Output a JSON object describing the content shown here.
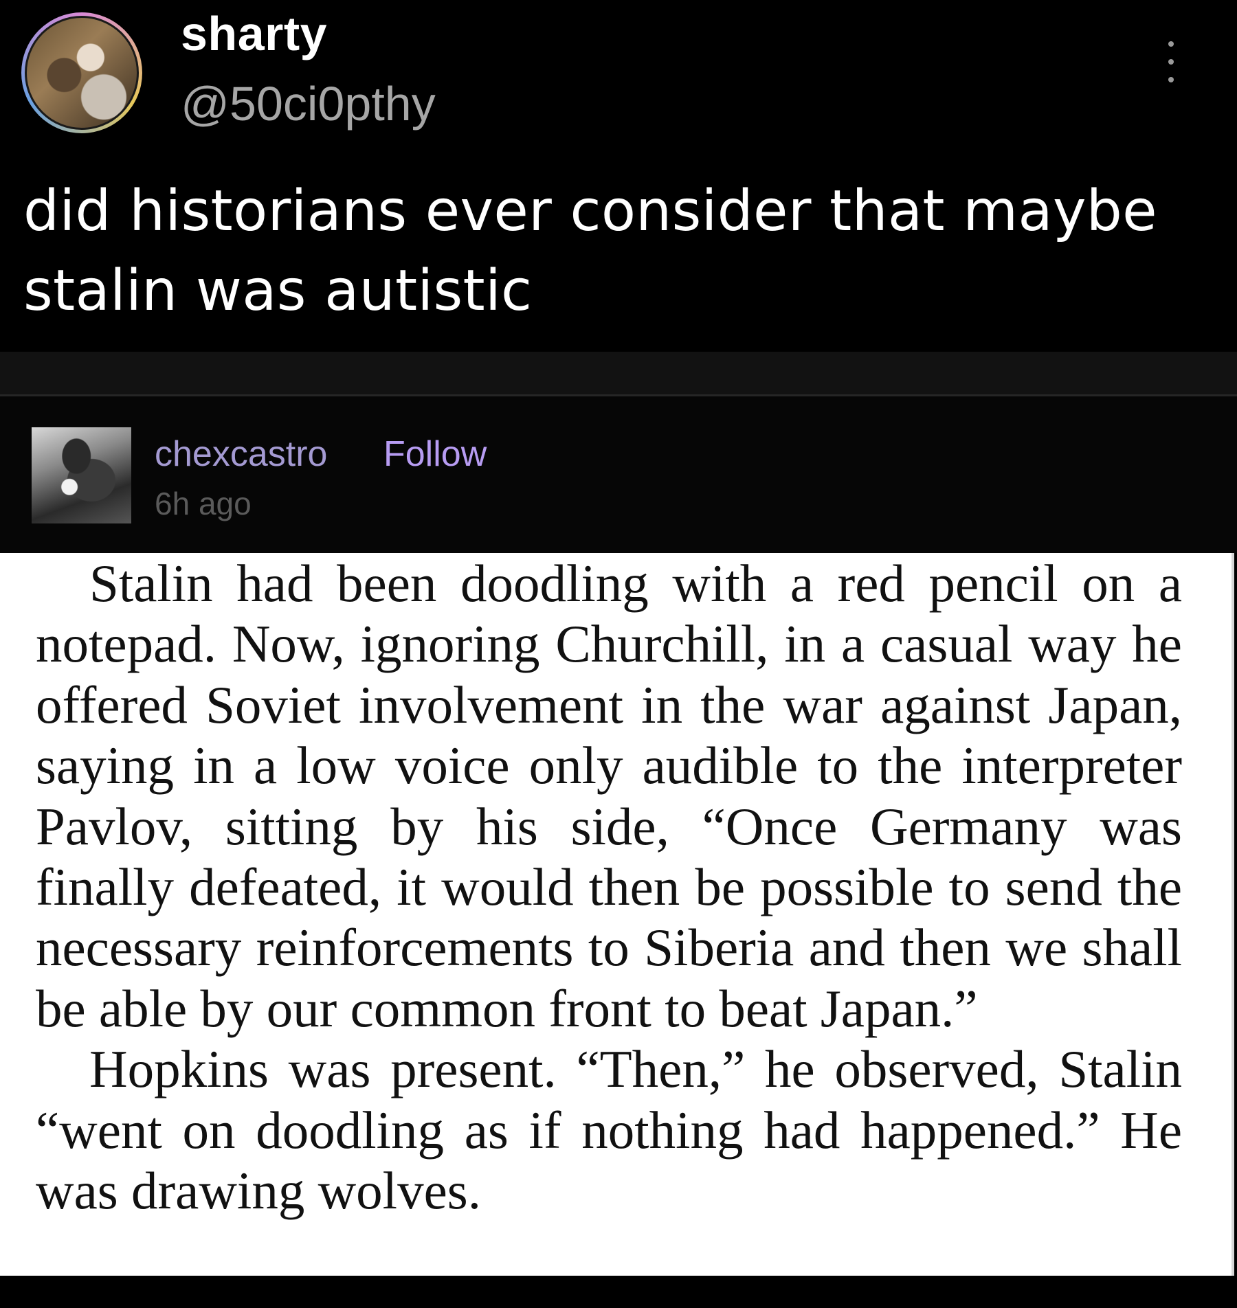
{
  "post": {
    "display_name": "sharty",
    "handle": "@50ci0pthy",
    "text": "did historians ever consider that maybe stalin was autistic"
  },
  "reply": {
    "username": "chexcastro",
    "follow_label": "Follow",
    "time_ago": "6h ago"
  },
  "excerpt": {
    "paragraphs": [
      "Stalin had been doodling with a red pencil on a notepad. Now, ignoring Churchill, in a casual way he offered Soviet involvement in the war against Japan, saying in a low voice only audible to the interpreter Pavlov, sitting by his side, “Once Germany was finally defeated, it would then be possible to send the necessary reinforcements to Siberia and then we shall be able by our common front to beat Japan.”",
      "Hopkins was present. “Then,” he observed, Stalin “went on doodling as if nothing had happened.” He was drawing wolves."
    ]
  },
  "icons": {
    "more": "more-vertical-icon"
  },
  "colors": {
    "background": "#000000",
    "reply_username": "#a49ad2",
    "follow": "#b79cf2",
    "muted_text": "#a6a6a6"
  }
}
